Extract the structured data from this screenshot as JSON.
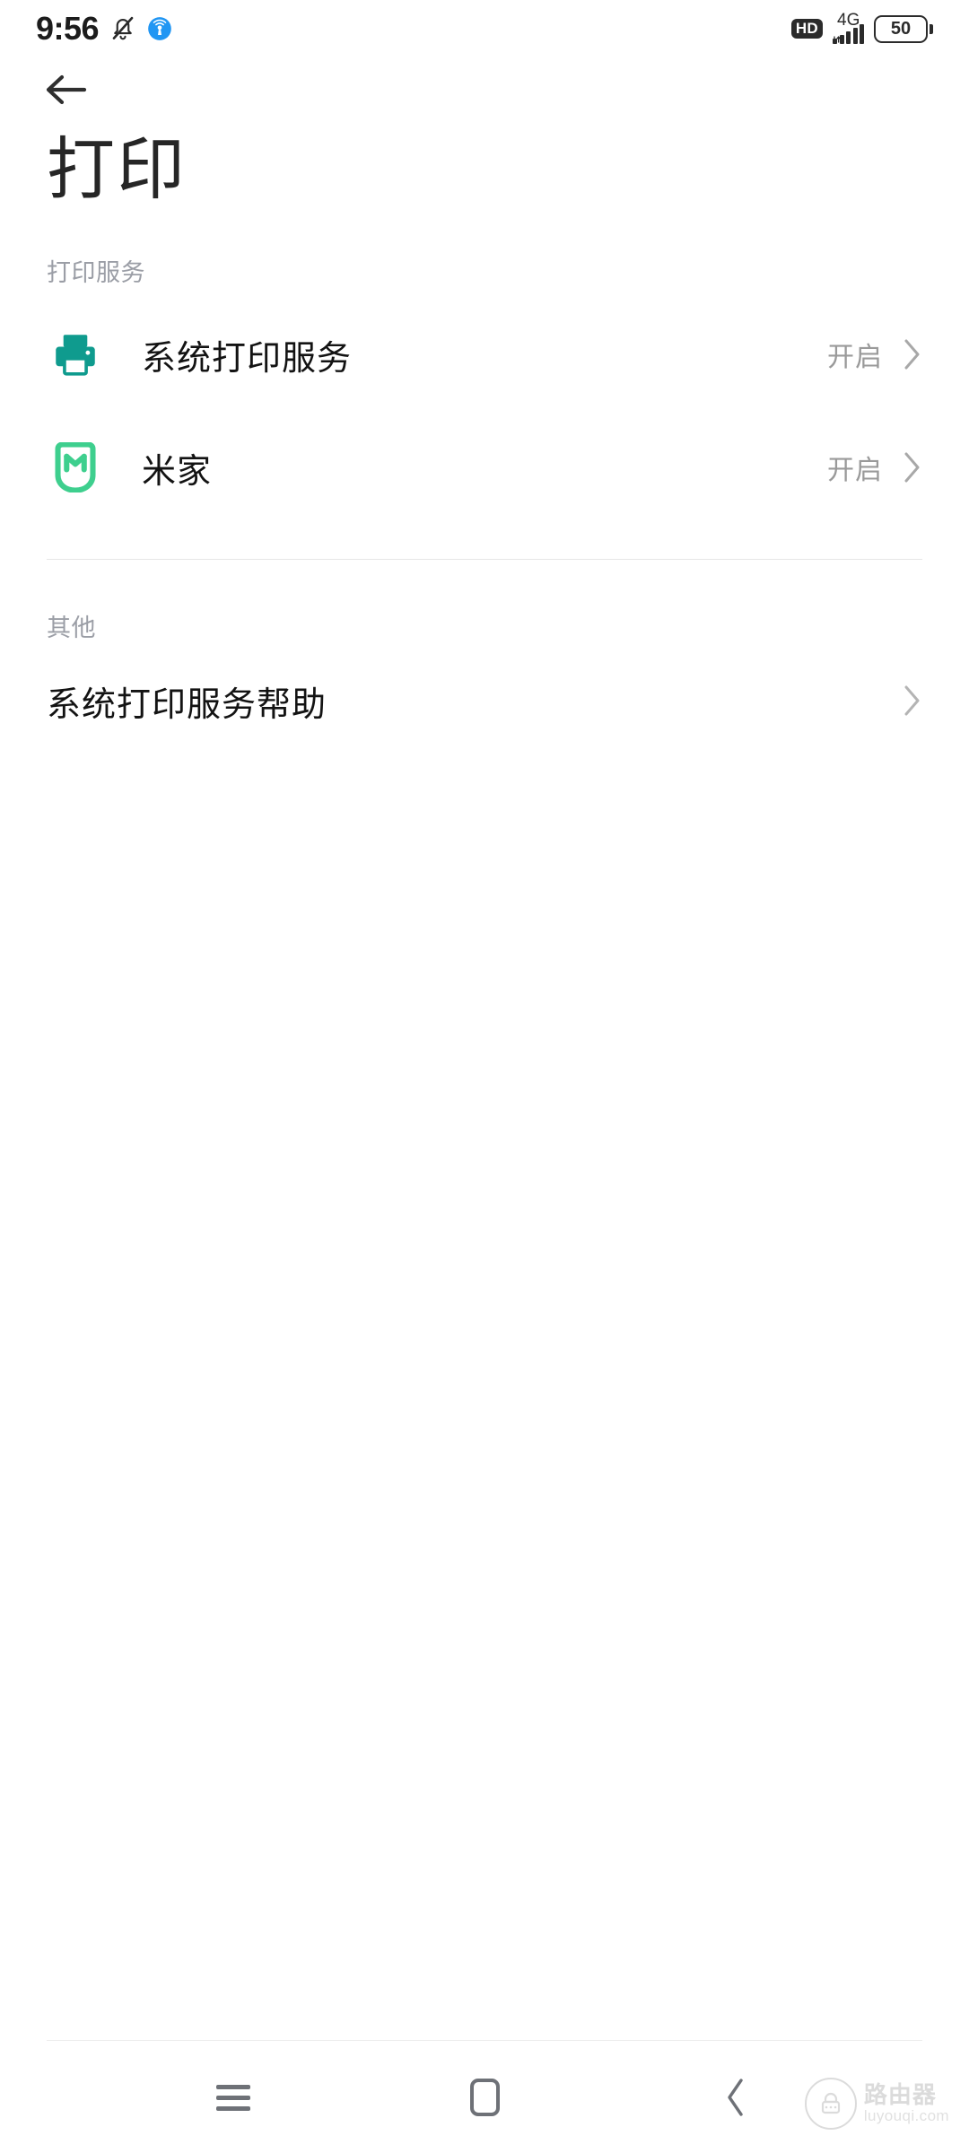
{
  "status_bar": {
    "time": "9:56",
    "mute_icon": "bell-muted-icon",
    "hotspot_icon": "hotspot-icon",
    "hd_label": "HD",
    "network_type": "4G",
    "signal_bars": 5,
    "battery_level": "50"
  },
  "header": {
    "back_icon": "arrow-left-icon",
    "title": "打印"
  },
  "sections": [
    {
      "header": "打印服务",
      "items": [
        {
          "icon": "printer-icon",
          "label": "系统打印服务",
          "value": "开启",
          "chevron": "chevron-right-icon"
        },
        {
          "icon": "mijia-logo-icon",
          "label": "米家",
          "value": "开启",
          "chevron": "chevron-right-icon"
        }
      ]
    },
    {
      "header": "其他",
      "items": [
        {
          "icon": "",
          "label": "系统打印服务帮助",
          "value": "",
          "chevron": "chevron-right-icon"
        }
      ]
    }
  ],
  "navbar": {
    "recents_label": "menu-icon",
    "home_label": "home-square-icon",
    "back_label": "chevron-left-icon"
  },
  "watermark": {
    "title": "路由器",
    "subtitle": "luyouqi.com",
    "icon": "router-lock-icon"
  },
  "colors": {
    "accent_teal": "#0f9b8e",
    "accent_green": "#3ecf8e",
    "text_primary": "#131313",
    "text_muted": "#9a9a9a",
    "divider": "#e6e6e6"
  }
}
